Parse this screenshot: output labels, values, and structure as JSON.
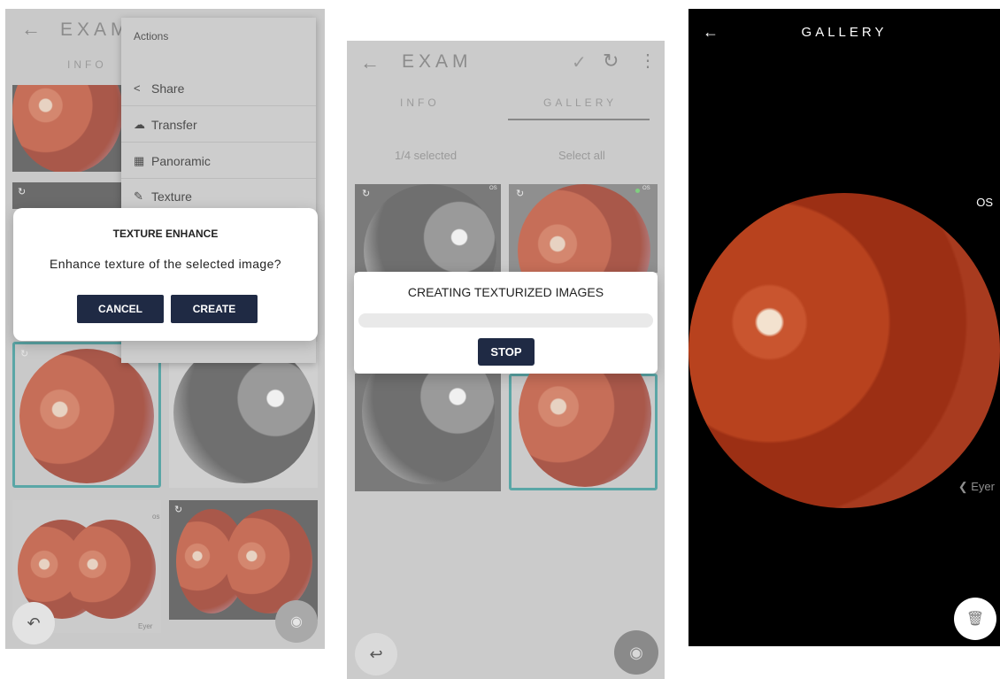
{
  "panel1": {
    "title": "EXAM",
    "tab_info": "INFO",
    "menu": {
      "title": "Actions",
      "items": [
        {
          "label": "Share",
          "icon": "share-icon"
        },
        {
          "label": "Transfer",
          "icon": "cloud-upload-icon"
        },
        {
          "label": "Panoramic",
          "icon": "image-icon"
        },
        {
          "label": "Texture",
          "icon": "brush-icon"
        }
      ]
    },
    "dialog": {
      "title": "TEXTURE ENHANCE",
      "message": "Enhance texture of the selected image?",
      "cancel": "CANCEL",
      "create": "CREATE"
    },
    "small_os": "os",
    "brand": "Eyer"
  },
  "panel2": {
    "title": "EXAM",
    "tab_info": "INFO",
    "tab_gallery": "GALLERY",
    "selected": "1/4 selected",
    "select_all": "Select all",
    "os_label": "OS",
    "dialog": {
      "title": "CREATING TEXTURIZED IMAGES",
      "stop": "STOP",
      "progress": 0
    }
  },
  "panel3": {
    "title": "GALLERY",
    "eye": "OS",
    "brand": "Eyer"
  },
  "colors": {
    "dialog_button": "#1f2a44",
    "selection_border": "#5aa6a6"
  }
}
